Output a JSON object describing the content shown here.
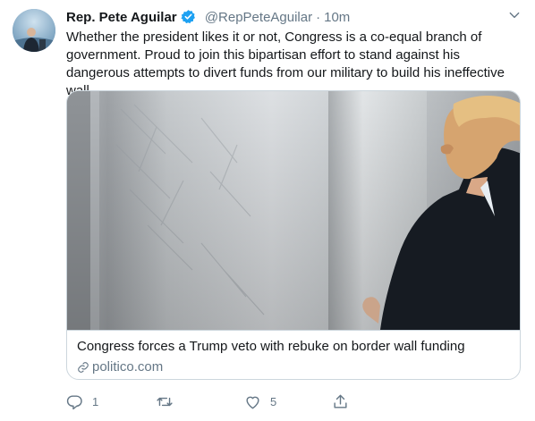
{
  "tweet": {
    "author_name": "Rep. Pete Aguilar",
    "handle": "@RepPeteAguilar",
    "separator": "·",
    "time": "10m",
    "text": "Whether the president likes it or not, Congress is a co-equal branch of government. Proud to join this bipartisan effort to stand against his dangerous attempts to divert funds from our military to build his ineffective wall.",
    "icons": {
      "verified": "verified-badge-icon",
      "menu": "chevron-down-icon"
    }
  },
  "card": {
    "title": "Congress forces a Trump veto with rebuke on border wall funding",
    "domain": "politico.com",
    "domain_icon": "link-icon"
  },
  "actions": {
    "reply_count": "1",
    "retweet_count": "",
    "like_count": "5",
    "icons": [
      "reply-icon",
      "retweet-icon",
      "like-icon",
      "share-icon"
    ]
  },
  "colors": {
    "primary_text": "#14171a",
    "secondary_text": "#657786",
    "verified_blue": "#1da1f2",
    "border": "#ccd6dd"
  }
}
